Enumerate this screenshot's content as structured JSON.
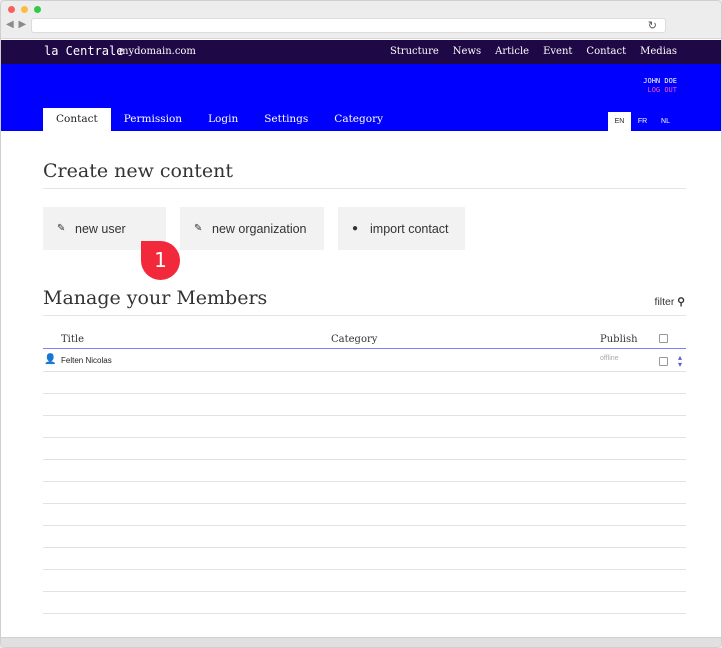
{
  "site": {
    "logo": "la Centrale",
    "domain": "mydomain.com",
    "nav": [
      "Structure",
      "News",
      "Article",
      "Event",
      "Contact",
      "Medias"
    ],
    "nav_active": "Contact"
  },
  "user": {
    "name": "JOHN DOE",
    "logout": "LOG OUT"
  },
  "subtabs": [
    "Contact",
    "Permission",
    "Login",
    "Settings",
    "Category"
  ],
  "languages": [
    "EN",
    "FR",
    "NL"
  ],
  "create": {
    "title": "Create new content",
    "buttons": [
      {
        "label": "new user",
        "icon": "pencil-icon"
      },
      {
        "label": "new organization",
        "icon": "pencil-icon"
      },
      {
        "label": "import contact",
        "icon": "download-circle-icon"
      }
    ],
    "badge": "1"
  },
  "members": {
    "title": "Manage your Members",
    "filter": "filter",
    "columns": {
      "title": "Title",
      "category": "Category",
      "publish": "Publish"
    },
    "rows": [
      {
        "name": "Felten Nicolas",
        "status": "offline"
      }
    ]
  },
  "colors": {
    "topbar": "#1e0845",
    "header": "#0000ff",
    "logout": "#ff4fc8",
    "badge": "#f2293b"
  }
}
